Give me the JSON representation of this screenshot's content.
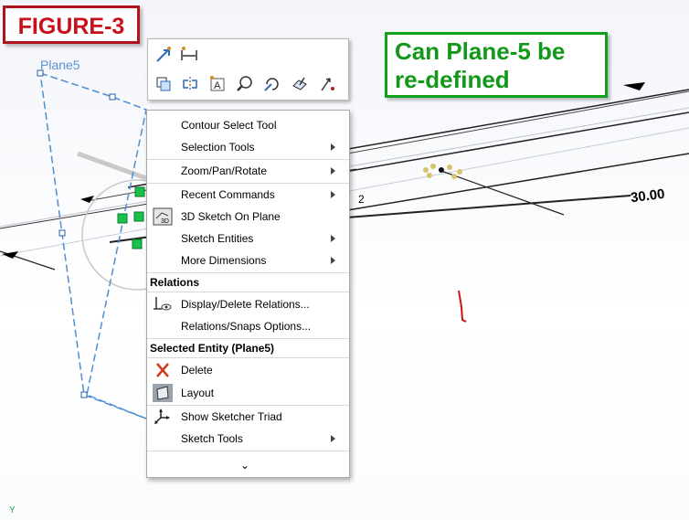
{
  "figure_label": "FIGURE-3",
  "question": {
    "line1": "Can Plane-5 be",
    "line2": "re-defined"
  },
  "plane_label": "Plane5",
  "dimension_value": "30.00",
  "dimension_small": "2",
  "origin_axis_label": "Y",
  "toolbar": {
    "row1": [
      "smart-dimension-icon",
      "horizontal-dimension-icon"
    ],
    "row2": [
      "copy-entities-icon",
      "mirror-entities-icon",
      "text-icon",
      "zoom-to-selection-icon",
      "rotate-view-icon",
      "normal-to-icon",
      "pointer-icon"
    ]
  },
  "menu": {
    "items_top": [
      {
        "label": "Contour Select Tool",
        "submenu": false
      },
      {
        "label": "Selection Tools",
        "submenu": true
      },
      {
        "label": "Zoom/Pan/Rotate",
        "submenu": true
      },
      {
        "label": "Recent Commands",
        "submenu": true
      },
      {
        "label": "3D Sketch On Plane",
        "submenu": false,
        "icon": "3d-sketch-icon"
      },
      {
        "label": "Sketch Entities",
        "submenu": true
      },
      {
        "label": "More Dimensions",
        "submenu": true
      }
    ],
    "relations_header": "Relations",
    "relations_items": [
      {
        "label": "Display/Delete Relations...",
        "icon": "display-relations-icon"
      },
      {
        "label": "Relations/Snaps Options..."
      }
    ],
    "selected_header": "Selected Entity (Plane5)",
    "selected_items": [
      {
        "label": "Delete",
        "icon": "delete-icon"
      },
      {
        "label": "Layout",
        "icon": "layout-icon"
      }
    ],
    "bottom_items": [
      {
        "label": "Show Sketcher Triad",
        "icon": "triad-icon"
      },
      {
        "label": "Sketch Tools",
        "submenu": true
      }
    ],
    "expand_glyph": "⌄"
  },
  "colors": {
    "figure_red": "#c8101c",
    "question_green": "#129919",
    "plane_blue": "#5b93cf"
  }
}
